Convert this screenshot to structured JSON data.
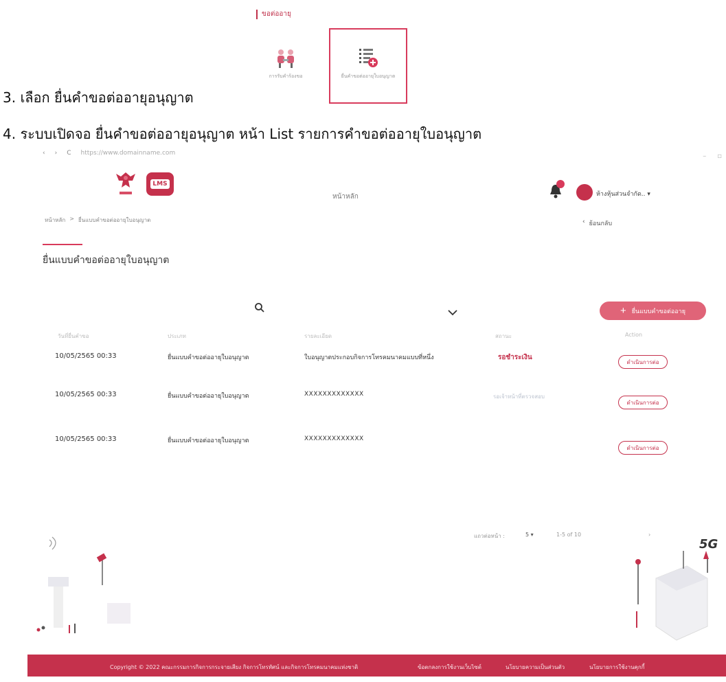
{
  "doc_snippet": {
    "tag": "ขอต่ออายุ",
    "menu": [
      {
        "label": "การรับคำร้องขอ",
        "icon": "people-meeting-icon"
      },
      {
        "label": "ยื่นคำขอต่ออายุใบอนุญาต",
        "icon": "list-add-icon"
      }
    ]
  },
  "instructions": [
    "3.  เลือก ยื่นคำขอต่ออายุอนุญาต",
    "4.  ระบบเปิดจอ ยื่นคำขอต่ออายุอนุญาต หน้า List รายการคำขอต่ออายุใบอนุญาต"
  ],
  "browser": {
    "url": "https://www.domainname.com"
  },
  "header": {
    "nav_home": "หน้าหลัก",
    "user_name": "ห้างหุ้นส่วนจำกัด..",
    "lms_logo_text": "LMS"
  },
  "breadcrumb": {
    "home": "หน้าหลัก",
    "sep": ">",
    "current": "ยื่นแบบคำขอต่ออายุใบอนุญาต"
  },
  "back_label": "ย้อนกลับ",
  "page_title": "ยื่นแบบคำขอต่ออายุใบอนุญาต",
  "toolbar": {
    "new_button": "ยื่นแบบคำขอต่ออายุ"
  },
  "table": {
    "headers": [
      "วันที่ยื่นคำขอ",
      "ประเภท",
      "รายละเอียด",
      "สถานะ",
      "Action"
    ],
    "rows": [
      {
        "date": "10/05/2565  00:33",
        "type": "ยื่นแบบคำขอต่ออายุใบอนุญาต",
        "detail": "ใบอนุญาตประกอบกิจการโทรคมนาคมแบบที่หนึ่ง",
        "status": "รอชำระเงิน",
        "action": "ดำเนินการต่อ"
      },
      {
        "date": "10/05/2565  00:33",
        "type": "ยื่นแบบคำขอต่ออายุใบอนุญาต",
        "detail": "XXXXXXXXXXXXX",
        "status": "รอเจ้าหน้าที่ตรวจสอบ",
        "action": "ดำเนินการต่อ"
      },
      {
        "date": "10/05/2565  00:33",
        "type": "ยื่นแบบคำขอต่ออายุใบอนุญาต",
        "detail": "XXXXXXXXXXXXX",
        "status": "",
        "action": "ดำเนินการต่อ"
      }
    ]
  },
  "pagination": {
    "rows_per_page_label": "แถวต่อหน้า :",
    "rows_per_page": "5",
    "range": "1-5 of 10"
  },
  "illustration": {
    "label_5g": "5G"
  },
  "footer": {
    "copyright": "Copyright © 2022 คณะกรรมการกิจการกระจายเสียง กิจการโทรทัศน์ และกิจการโทรคมนาคมแห่งชาติ",
    "links": [
      "ข้อตกลงการใช้งานเว็บไซต์",
      "นโยบายความเป็นส่วนตัว",
      "นโยบายการใช้งานคุกกี้"
    ]
  },
  "colors": {
    "brand": "#c5314c",
    "button": "#e06478"
  }
}
